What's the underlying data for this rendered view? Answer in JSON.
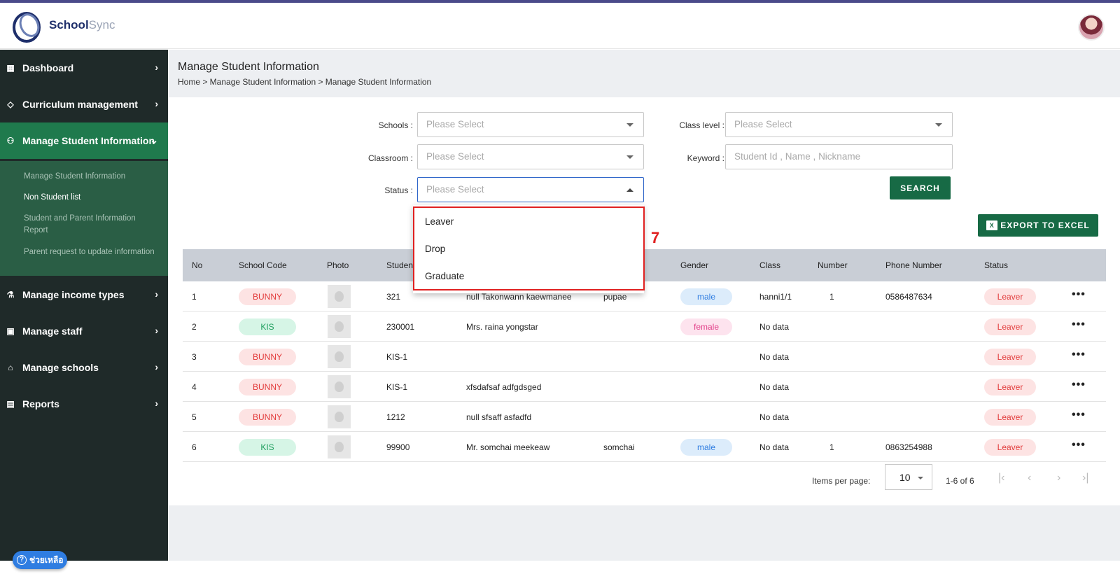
{
  "app": {
    "logo_primary": "School",
    "logo_secondary": "Sync"
  },
  "sidebar": {
    "items": [
      {
        "label": "Dashboard",
        "icon": "grid-icon"
      },
      {
        "label": "Curriculum management",
        "icon": "graduation-cap-icon"
      },
      {
        "label": "Manage Student Information",
        "icon": "student-icon"
      },
      {
        "label": "Manage income types",
        "icon": "flask-icon"
      },
      {
        "label": "Manage staff",
        "icon": "id-card-icon"
      },
      {
        "label": "Manage schools",
        "icon": "school-icon"
      },
      {
        "label": "Reports",
        "icon": "clipboard-icon"
      }
    ],
    "submenu": [
      "Manage Student Information",
      "Non Student list",
      "Student and Parent Information Report",
      "Parent request to update information"
    ],
    "help_label": "ช่วยเหลือ"
  },
  "page": {
    "title": "Manage Student Information",
    "breadcrumb": "Home > Manage Student Information > Manage Student Information"
  },
  "filters": {
    "schools_label": "Schools :",
    "classroom_label": "Classroom :",
    "status_label": "Status :",
    "class_level_label": "Class level :",
    "keyword_label": "Keyword :",
    "placeholder": "Please Select",
    "keyword_placeholder": "Student Id , Name , Nickname",
    "search_button": "SEARCH",
    "export_button": "EXPORT TO EXCEL",
    "status_options": [
      "Leaver",
      "Drop",
      "Graduate"
    ],
    "annotation_number": "7"
  },
  "table": {
    "headers": [
      "No",
      "School Code",
      "Photo",
      "Studen",
      "Gender",
      "Class",
      "Number",
      "Phone Number",
      "Status"
    ],
    "rows": [
      {
        "no": "1",
        "school": "BUNNY",
        "student_id": "321",
        "name": "null Takonwann kaewmanee",
        "nickname": "pupae",
        "gender": "male",
        "class": "hanni1/1",
        "number": "1",
        "phone": "0586487634",
        "status": "Leaver"
      },
      {
        "no": "2",
        "school": "KIS",
        "student_id": "230001",
        "name": "Mrs. raina yongstar",
        "nickname": "",
        "gender": "female",
        "class": "No data",
        "number": "",
        "phone": "",
        "status": "Leaver"
      },
      {
        "no": "3",
        "school": "BUNNY",
        "student_id": "KIS-1",
        "name": "",
        "nickname": "",
        "gender": "",
        "class": "No data",
        "number": "",
        "phone": "",
        "status": "Leaver"
      },
      {
        "no": "4",
        "school": "BUNNY",
        "student_id": "KIS-1",
        "name": "xfsdafsaf adfgdsged",
        "nickname": "",
        "gender": "",
        "class": "No data",
        "number": "",
        "phone": "",
        "status": "Leaver"
      },
      {
        "no": "5",
        "school": "BUNNY",
        "student_id": "1212",
        "name": "null sfsaff asfadfd",
        "nickname": "",
        "gender": "",
        "class": "No data",
        "number": "",
        "phone": "",
        "status": "Leaver"
      },
      {
        "no": "6",
        "school": "KIS",
        "student_id": "99900",
        "name": "Mr. somchai meekeaw",
        "nickname": "somchai",
        "gender": "male",
        "class": "No data",
        "number": "1",
        "phone": "0863254988",
        "status": "Leaver"
      }
    ]
  },
  "pagination": {
    "items_per_page_label": "Items per page:",
    "items_per_page_value": "10",
    "range": "1-6 of 6"
  },
  "colors": {
    "sidebar_bg": "#1f2a29",
    "active_green": "#1f7a4d",
    "button_green": "#176a45",
    "annotation_red": "#e02020"
  }
}
